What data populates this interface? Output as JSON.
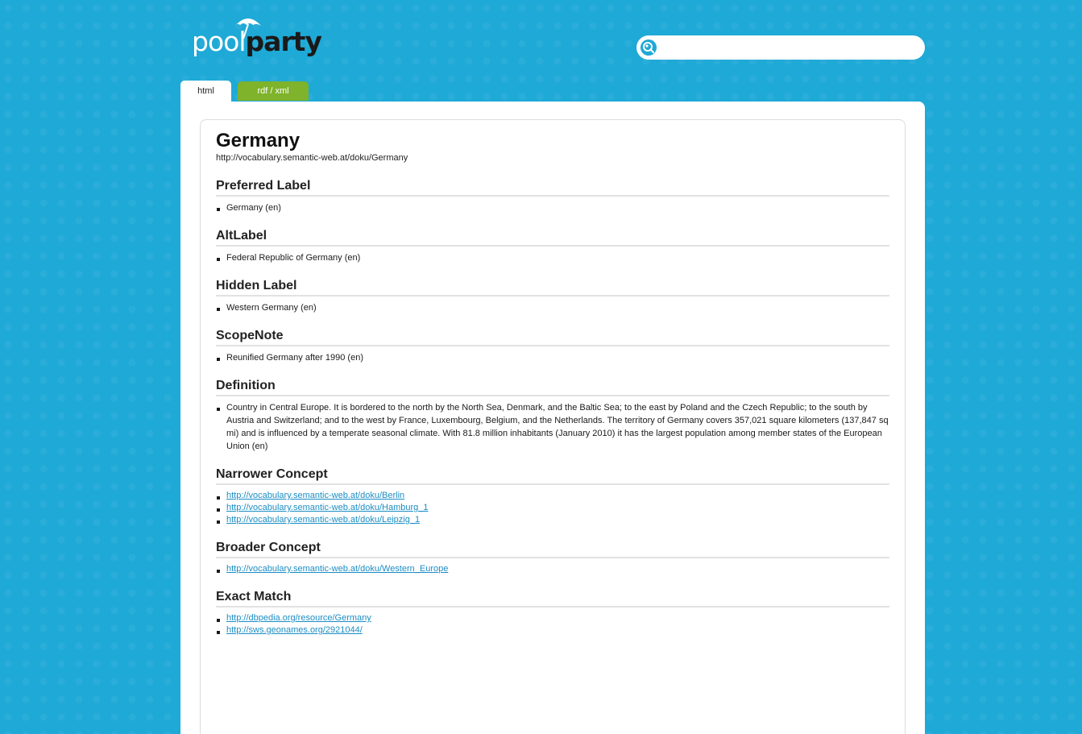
{
  "logo": {
    "part1": "pool",
    "part2": "party"
  },
  "search": {
    "placeholder": "",
    "value": ""
  },
  "tabs": [
    {
      "label": "html",
      "active": true
    },
    {
      "label": "rdf / xml",
      "active": false
    }
  ],
  "concept": {
    "title": "Germany",
    "uri": "http://vocabulary.semantic-web.at/doku/Germany"
  },
  "sections": {
    "preferred_label": {
      "title": "Preferred Label",
      "items": [
        "Germany (en)"
      ]
    },
    "alt_label": {
      "title": "AltLabel",
      "items": [
        "Federal Republic of Germany (en)"
      ]
    },
    "hidden_label": {
      "title": "Hidden Label",
      "items": [
        "Western Germany (en)"
      ]
    },
    "scope_note": {
      "title": "ScopeNote",
      "items": [
        "Reunified Germany after 1990 (en)"
      ]
    },
    "definition": {
      "title": "Definition",
      "items": [
        "Country in Central Europe. It is bordered to the north by the North Sea, Denmark, and the Baltic Sea; to the east by Poland and the Czech Republic; to the south by Austria and Switzerland; and to the west by France, Luxembourg, Belgium, and the Netherlands. The territory of Germany covers 357,021 square kilometers (137,847 sq mi) and is influenced by a temperate seasonal climate. With 81.8 million inhabitants (January 2010) it has the largest population among member states of the European Union (en)"
      ]
    },
    "narrower": {
      "title": "Narrower Concept",
      "items": [
        "http://vocabulary.semantic-web.at/doku/Berlin",
        "http://vocabulary.semantic-web.at/doku/Hamburg_1",
        "http://vocabulary.semantic-web.at/doku/Leipzig_1"
      ]
    },
    "broader": {
      "title": "Broader Concept",
      "items": [
        "http://vocabulary.semantic-web.at/doku/Western_Europe"
      ]
    },
    "exact_match": {
      "title": "Exact Match",
      "items": [
        "http://dbpedia.org/resource/Germany",
        "http://sws.geonames.org/2921044/"
      ]
    }
  },
  "colors": {
    "background": "#1fa9d6",
    "tab_inactive": "#7eb32b",
    "link": "#1a8dc4"
  },
  "icons": {
    "search": "search-icon",
    "logo": "umbrella-icon"
  }
}
